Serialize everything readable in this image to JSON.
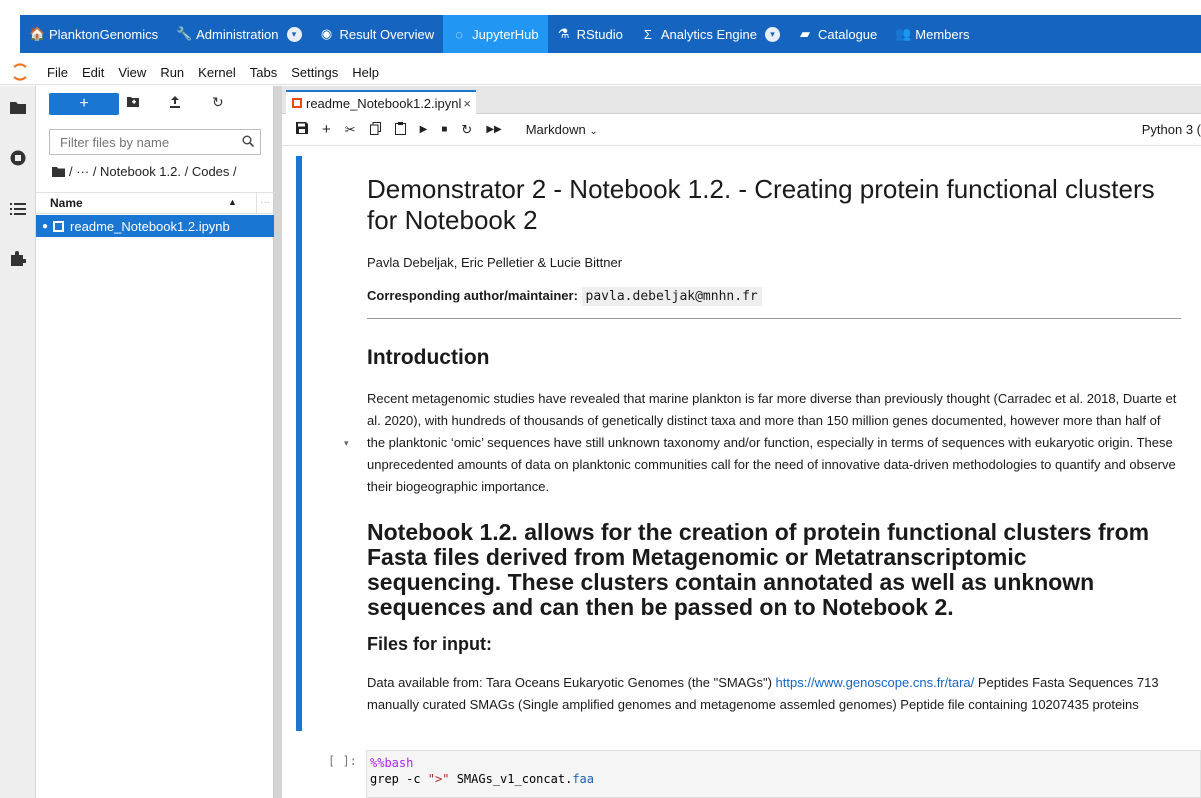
{
  "topnav": {
    "items": [
      {
        "icon": "home-icon",
        "glyph": "🏠",
        "label": "PlanktonGenomics",
        "dropdown": false,
        "active": false
      },
      {
        "icon": "wrench-icon",
        "glyph": "🔧",
        "label": "Administration",
        "dropdown": true,
        "active": false
      },
      {
        "icon": "globe-icon",
        "glyph": "◉",
        "label": "Result Overview",
        "dropdown": false,
        "active": false
      },
      {
        "icon": "jupyter-icon",
        "glyph": "◌",
        "label": "JupyterHub",
        "dropdown": false,
        "active": true
      },
      {
        "icon": "flask-icon",
        "glyph": "⚗",
        "label": "RStudio",
        "dropdown": false,
        "active": false
      },
      {
        "icon": "sigma-icon",
        "glyph": "Σ",
        "label": "Analytics Engine",
        "dropdown": true,
        "active": false
      },
      {
        "icon": "book-icon",
        "glyph": "▰",
        "label": "Catalogue",
        "dropdown": false,
        "active": false
      },
      {
        "icon": "users-icon",
        "glyph": "👥",
        "label": "Members",
        "dropdown": false,
        "active": false
      }
    ],
    "colors": {
      "bar": "#1565c0",
      "active": "#2196f3"
    }
  },
  "menubar": {
    "items": [
      "File",
      "Edit",
      "View",
      "Run",
      "Kernel",
      "Tabs",
      "Settings",
      "Help"
    ]
  },
  "filebrowser": {
    "new_label": "+",
    "filter_placeholder": "Filter files by name",
    "breadcrumb": "/ ··· / Notebook 1.2. / Codes /",
    "column_name": "Name",
    "files": [
      {
        "name": "readme_Notebook1.2.ipynb",
        "selected": true,
        "running": true
      }
    ]
  },
  "tab": {
    "label": "readme_Notebook1.2.ipynl",
    "close": "×"
  },
  "toolbar": {
    "cell_type": "Markdown",
    "kernel": "Python 3 ("
  },
  "notebook": {
    "title": "Demonstrator 2 - Notebook 1.2. - Creating protein functional clusters for Notebook 2",
    "authors": "Pavla Debeljak, Eric Pelletier & Lucie Bittner",
    "corresponding_label": "Corresponding author/maintainer:",
    "corresponding_email": "pavla.debeljak@mnhn.fr",
    "intro_heading": "Introduction",
    "intro_text": "Recent metagenomic studies have revealed that marine plankton is far more diverse than previously thought (Carradec et al. 2018, Duarte et al. 2020), with hundreds of thousands of genetically distinct taxa and more than 150 million genes documented, however more than half of the planktonic ‘omic’ sequences have still unknown taxonomy and/or function, especially in terms of sequences with eukaryotic origin. These unprecedented amounts of data on planktonic communities call for the need of innovative data-driven methodologies to quantify and observe their biogeographic importance.",
    "big_heading": "Notebook 1.2. allows for the creation of protein functional clusters from Fasta files derived from Metagenomic or Metatranscriptomic sequencing. These clusters contain annotated as well as unknown sequences and can then be passed on to Notebook 2.",
    "files_heading": "Files for input:",
    "data_text_before": "Data available from: Tara Oceans Eukaryotic Genomes (the \"SMAGs\") ",
    "data_link": "https://www.genoscope.cns.fr/tara/",
    "data_text_after": " Peptides Fasta Sequences 713 manually curated SMAGs (Single amplified genomes and metagenome assemled genomes) Peptide file containing 10207435 proteins",
    "code_prompt": "[ ]:",
    "code_magic": "%%bash",
    "code_cmd": "grep -c ",
    "code_str": "\">\"",
    "code_file": " SMAGs_v1_concat.",
    "code_ext": "faa"
  }
}
